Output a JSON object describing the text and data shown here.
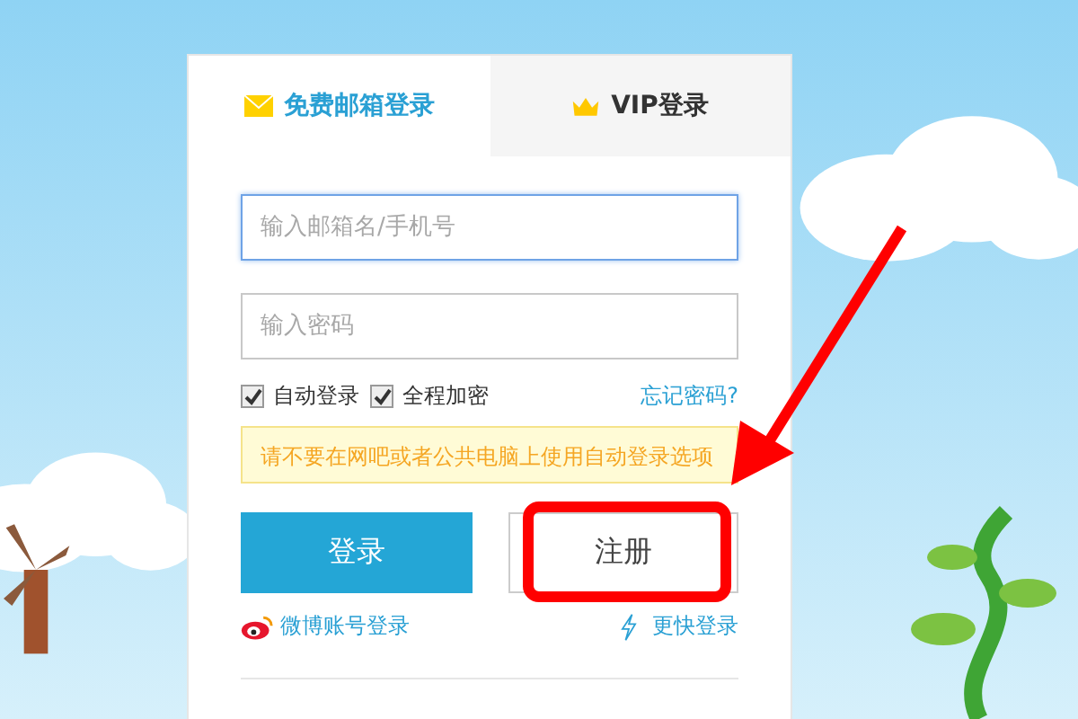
{
  "tabs": [
    {
      "label": "免费邮箱登录",
      "kind": "mail",
      "selected": true
    },
    {
      "label": "VIP登录",
      "kind": "vip",
      "selected": false
    }
  ],
  "email_field": {
    "placeholder": "输入邮箱名/手机号",
    "focused": true
  },
  "password_field": {
    "placeholder": "输入密码"
  },
  "options": [
    {
      "label": "自动登录",
      "checked": true
    },
    {
      "label": "全程加密",
      "checked": true
    }
  ],
  "forgot_link": "忘记密码?",
  "notice": "请不要在网吧或者公共电脑上使用自动登录选项",
  "buttons": [
    {
      "label": "登录",
      "kind": "primary"
    },
    {
      "label": "注册",
      "kind": "secondary",
      "highlighted": true
    }
  ],
  "links": [
    {
      "label": "微博账号登录",
      "kind": "weibo"
    },
    {
      "label": "更快登录",
      "kind": "quick"
    }
  ]
}
